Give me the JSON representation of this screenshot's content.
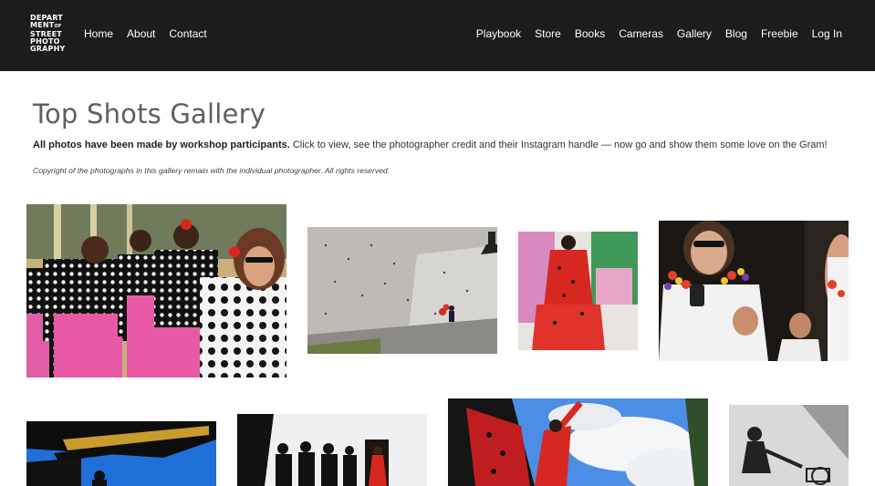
{
  "logo": {
    "line1": "DEPART",
    "line2": "MENT",
    "line2_small": "OF",
    "line3": "STREET",
    "line4": "PHOTO",
    "line5": "GRAPHY"
  },
  "nav": {
    "left": [
      "Home",
      "About",
      "Contact"
    ],
    "right": [
      "Playbook",
      "Store",
      "Books",
      "Cameras",
      "Gallery",
      "Blog",
      "Freebie",
      "Log In"
    ]
  },
  "page": {
    "title": "Top Shots Gallery",
    "intro_bold": "All photos have been made by workshop participants.",
    "intro_rest": " Click to view, see the photographer credit and their Instagram handle — now go and show them some love on the Gram!",
    "copyright": "Copyright of the photographs in this gallery remain with the individual photographer. All rights reserved."
  },
  "colors": {
    "header_bg": "#1c1c1c",
    "title": "#606060",
    "accent_pink": "#e85aa6",
    "accent_red": "#d62820"
  }
}
